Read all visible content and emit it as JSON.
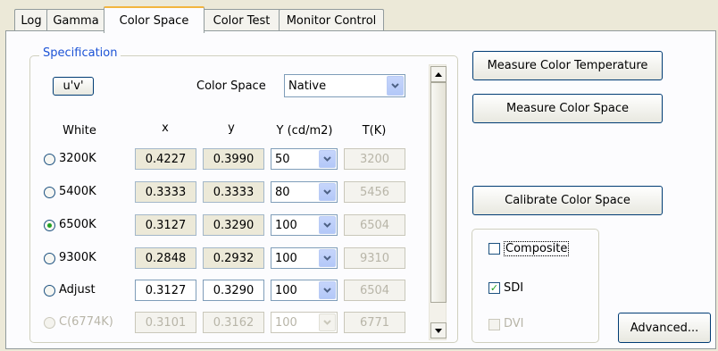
{
  "tabs": [
    {
      "label": "Log"
    },
    {
      "label": "Gamma"
    },
    {
      "label": "Color Space"
    },
    {
      "label": "Color Test"
    },
    {
      "label": "Monitor Control"
    }
  ],
  "spec": {
    "title": "Specification",
    "uv_button": "u'v'",
    "color_space_label": "Color Space",
    "color_space_value": "Native",
    "headers": {
      "white": "White",
      "x": "x",
      "y": "y",
      "Y": "Y (cd/m2)",
      "T": "T(K)"
    },
    "rows": [
      {
        "label": "3200K",
        "x": "0.4227",
        "y": "0.3990",
        "Y": "50",
        "T": "3200"
      },
      {
        "label": "5400K",
        "x": "0.3333",
        "y": "0.3333",
        "Y": "80",
        "T": "5456"
      },
      {
        "label": "6500K",
        "x": "0.3127",
        "y": "0.3290",
        "Y": "100",
        "T": "6504"
      },
      {
        "label": "9300K",
        "x": "0.2848",
        "y": "0.2932",
        "Y": "100",
        "T": "9310"
      },
      {
        "label": "Adjust",
        "x": "0.3127",
        "y": "0.3290",
        "Y": "100",
        "T": "6504"
      },
      {
        "label": "C(6774K)",
        "x": "0.3101",
        "y": "0.3162",
        "Y": "100",
        "T": "6771"
      }
    ]
  },
  "actions": {
    "measure_temp": "Measure Color Temperature",
    "measure_space": "Measure Color Space",
    "calibrate": "Calibrate Color Space",
    "advanced": "Advanced..."
  },
  "outputs": {
    "composite": "Composite",
    "sdi": "SDI",
    "dvi": "DVI"
  },
  "colors": {
    "accent": "#1c53d6",
    "check": "#21a121"
  }
}
